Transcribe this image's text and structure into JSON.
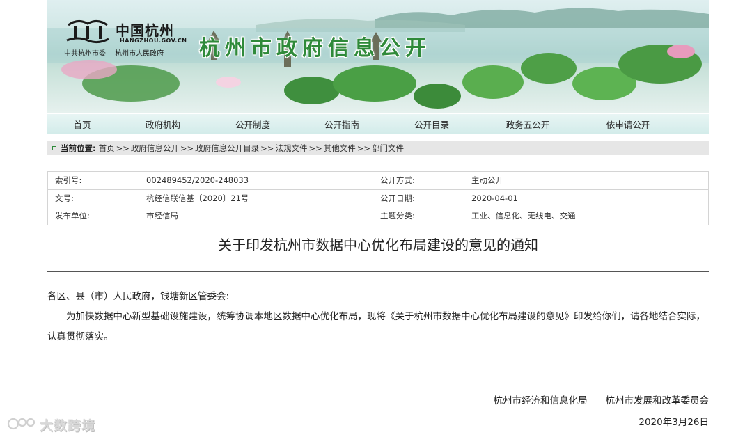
{
  "banner": {
    "logo_cn": "中国杭州",
    "logo_domain": "HANGZHOU.GOV.CN",
    "logo_sub_1": "中共杭州市委",
    "logo_sub_2": "杭州市人民政府",
    "site_title": "杭州市政府信息公开"
  },
  "nav": {
    "items": [
      {
        "label": "首页"
      },
      {
        "label": "政府机构"
      },
      {
        "label": "公开制度"
      },
      {
        "label": "公开指南"
      },
      {
        "label": "公开目录"
      },
      {
        "label": "政务五公开"
      },
      {
        "label": "依申请公开"
      }
    ]
  },
  "breadcrumb": {
    "label": "当前位置:",
    "separator": ">>",
    "items": [
      "首页",
      "政府信息公开",
      "政府信息公开目录",
      "法规文件",
      "其他文件",
      "部门文件"
    ]
  },
  "meta": {
    "rows": [
      {
        "k1": "索引号:",
        "v1": "002489452/2020-248033",
        "k2": "公开方式:",
        "v2": "主动公开"
      },
      {
        "k1": "文号:",
        "v1": "杭经信联信基〔2020〕21号",
        "k2": "公开日期:",
        "v2": "2020-04-01"
      },
      {
        "k1": "发布单位:",
        "v1": "市经信局",
        "k2": "主题分类:",
        "v2": "工业、信息化、无线电、交通"
      }
    ]
  },
  "document": {
    "title": "关于印发杭州市数据中心优化布局建设的意见的通知",
    "addressee": "各区、县（市）人民政府，钱塘新区管委会:",
    "body": "为加快数据中心新型基础设施建设，统筹协调本地区数据中心优化布局，现将《关于杭州市数据中心优化布局建设的意见》印发给你们，请各地结合实际，认真贯彻落实。",
    "signers": [
      "杭州市经济和信息化局",
      "杭州市发展和改革委员会"
    ],
    "date": "2020年3月26日"
  },
  "watermark": {
    "text": "大数跨境"
  },
  "colors": {
    "title_green": "#2f8a3a",
    "nav_bg": "#d3ecea",
    "crumb_bg": "#e6e6e6",
    "rule": "#555555"
  }
}
